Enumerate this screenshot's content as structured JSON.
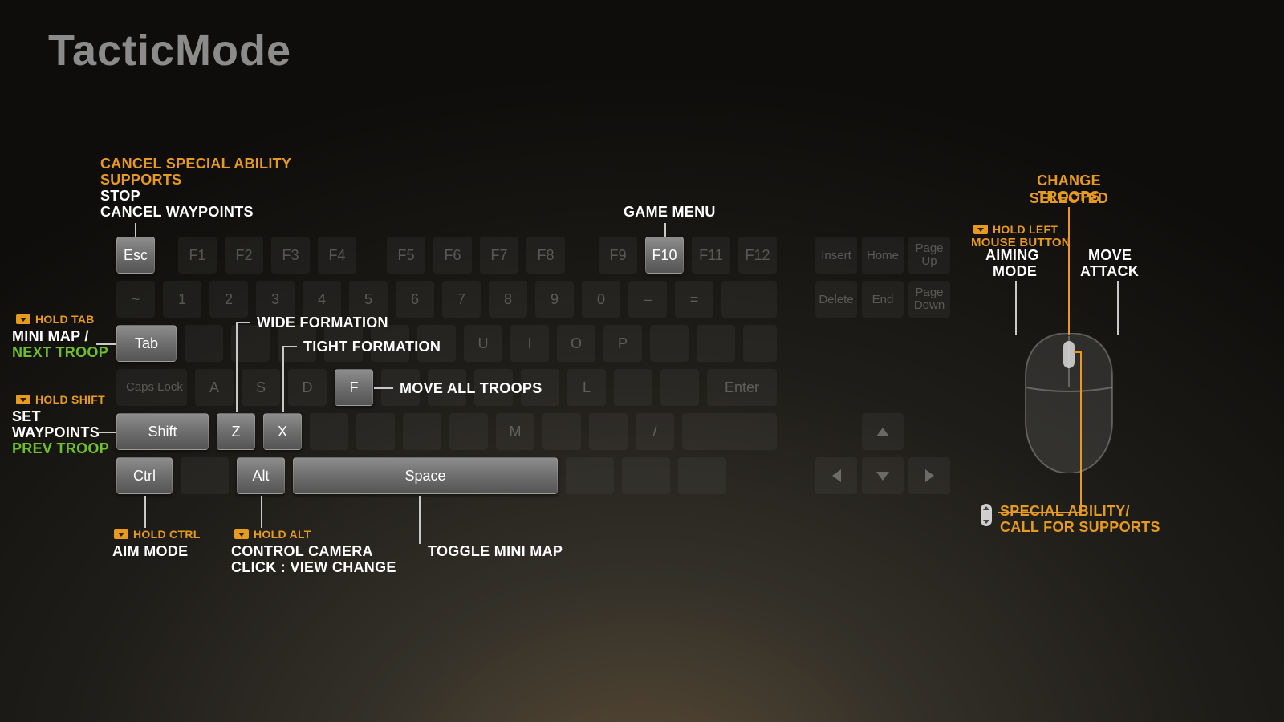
{
  "title": "TacticMode",
  "keys": {
    "esc": "Esc",
    "f1": "F1",
    "f2": "F2",
    "f3": "F3",
    "f4": "F4",
    "f5": "F5",
    "f6": "F6",
    "f7": "F7",
    "f8": "F8",
    "f9": "F9",
    "f10": "F10",
    "f11": "F11",
    "f12": "F12",
    "tilde": "~",
    "d1": "1",
    "d2": "2",
    "d3": "3",
    "d4": "4",
    "d5": "5",
    "d6": "6",
    "d7": "7",
    "d8": "8",
    "d9": "9",
    "d0": "0",
    "dash": "–",
    "equals": "=",
    "tab": "Tab",
    "u": "U",
    "i": "I",
    "o": "O",
    "p": "P",
    "caps": "Caps Lock",
    "a": "A",
    "s": "S",
    "d": "D",
    "f": "F",
    "l": "L",
    "enter": "Enter",
    "shift": "Shift",
    "z": "Z",
    "x": "X",
    "m": "M",
    "slash": "/",
    "ctrl": "Ctrl",
    "alt": "Alt",
    "space": "Space",
    "ins": "Insert",
    "home": "Home",
    "pgup_1": "Page",
    "pgup_2": "Up",
    "del": "Delete",
    "end": "End",
    "pgdn_1": "Page",
    "pgdn_2": "Down"
  },
  "ann": {
    "esc1": "CANCEL SPECIAL ABILITY",
    "esc2": "SUPPORTS",
    "esc3": "STOP",
    "esc4": "CANCEL WAYPOINTS",
    "f10": "GAME MENU",
    "tab_hold": "HOLD TAB",
    "tab1": "MINI MAP /",
    "tab2": "NEXT TROOP",
    "shift_hold": "HOLD SHIFT",
    "shift1": "SET",
    "shift2": "WAYPOINTS",
    "shift3": "PREV TROOP",
    "ctrl_hold": "HOLD CTRL",
    "ctrl1": "AIM MODE",
    "alt_hold": "HOLD ALT",
    "alt1": "CONTROL CAMERA",
    "alt2": "CLICK : VIEW CHANGE",
    "z": "WIDE FORMATION",
    "x": "TIGHT FORMATION",
    "f": "MOVE ALL TROOPS",
    "space": "TOGGLE MINI MAP",
    "mouse_top1": "CHANGE SELECTED",
    "mouse_top2": "TROOPS",
    "mouse_lmb_hold": "HOLD LEFT",
    "mouse_lmb_hold2": "MOUSE BUTTON",
    "mouse_lmb1": "AIMING",
    "mouse_lmb2": "MODE",
    "mouse_rmb1": "MOVE",
    "mouse_rmb2": "ATTACK",
    "mouse_wheel1": "SPECIAL ABILITY/",
    "mouse_wheel2": "CALL FOR SUPPORTS"
  }
}
